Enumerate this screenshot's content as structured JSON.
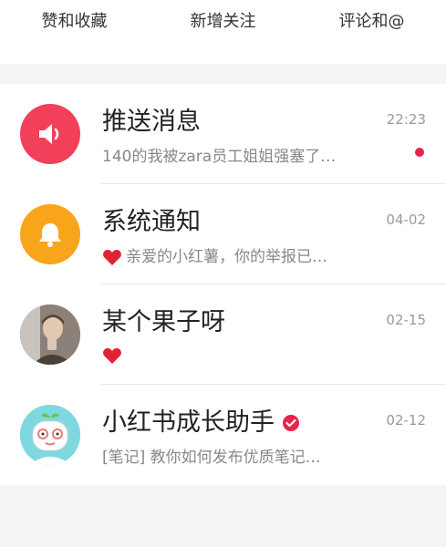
{
  "tabs": [
    "赞和收藏",
    "新增关注",
    "评论和@"
  ],
  "messages": [
    {
      "title": "推送消息",
      "subtitle": "140的我被zara员工姐姐强塞了…",
      "time": "22:23",
      "avatar_icon": "speaker-icon",
      "unread": true
    },
    {
      "title": "系统通知",
      "subtitle": "亲爱的小红薯，你的举报已…",
      "time": "04-02",
      "avatar_icon": "bell-icon",
      "has_heart": true
    },
    {
      "title": "某个果子呀",
      "subtitle": "",
      "time": "02-15",
      "avatar_icon": "user-photo",
      "has_heart": true
    },
    {
      "title": "小红书成长助手",
      "subtitle": "[笔记] 教你如何发布优质笔记…",
      "time": "02-12",
      "avatar_icon": "assistant-avatar",
      "verified": true
    }
  ],
  "colors": {
    "red": "#f2405a",
    "orange": "#f9a51b",
    "unread_dot": "#e8244a",
    "heart": "#e02434"
  }
}
